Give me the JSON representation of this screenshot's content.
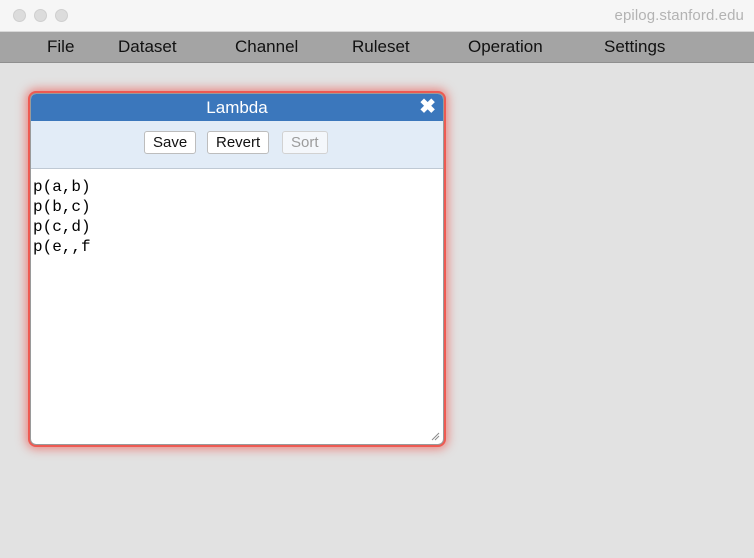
{
  "browser": {
    "url": "epilog.stanford.edu"
  },
  "menu": {
    "items": [
      "File",
      "Dataset",
      "Channel",
      "Ruleset",
      "Operation",
      "Settings"
    ]
  },
  "dialog": {
    "title": "Lambda",
    "close_label": "✖",
    "buttons": {
      "save": "Save",
      "revert": "Revert",
      "sort": "Sort"
    },
    "sort_enabled": false,
    "lines": [
      "p(a,b)",
      "p(b,c)",
      "p(c,d)",
      "p(e,,f"
    ]
  },
  "colors": {
    "header": "#3b77bc",
    "glow": "#ee5a52",
    "toolbar": "#e2ecf7",
    "menubar": "#a4a4a4",
    "background": "#e2e2e2"
  }
}
